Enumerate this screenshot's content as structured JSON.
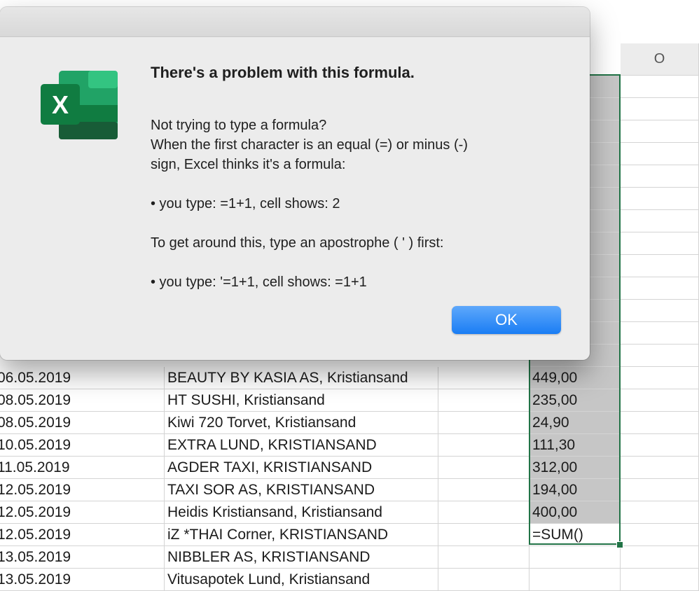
{
  "spreadsheet": {
    "column_o_header": "O",
    "rows": [
      {
        "date": "06.05.2019",
        "desc": "BEAUTY BY KASIA AS, Kristiansand",
        "amount": "449,00"
      },
      {
        "date": "08.05.2019",
        "desc": "HT SUSHI, Kristiansand",
        "amount": "235,00"
      },
      {
        "date": "08.05.2019",
        "desc": "Kiwi 720 Torvet, Kristiansand",
        "amount": "24,90"
      },
      {
        "date": "10.05.2019",
        "desc": "EXTRA LUND, KRISTIANSAND",
        "amount": "111,30"
      },
      {
        "date": "11.05.2019",
        "desc": "AGDER TAXI, KRISTIANSAND",
        "amount": "312,00"
      },
      {
        "date": "12.05.2019",
        "desc": "TAXI SOR AS, KRISTIANSAND",
        "amount": "194,00"
      },
      {
        "date": "12.05.2019",
        "desc": "Heidis Kristiansand, Kristiansand",
        "amount": "400,00"
      },
      {
        "date": "12.05.2019",
        "desc": "iZ *THAI Corner, KRISTIANSAND",
        "amount": "=SUM()"
      },
      {
        "date": "13.05.2019",
        "desc": "NIBBLER AS, KRISTIANSAND",
        "amount": ""
      },
      {
        "date": "13.05.2019",
        "desc": "Vitusapotek Lund, Kristiansand",
        "amount": ""
      }
    ],
    "accent_color": "#217346"
  },
  "dialog": {
    "icon": "excel-app-icon",
    "icon_letter": "X",
    "title": "There's a problem with this formula.",
    "line1": "Not trying to type a formula?",
    "line2": "When the first character is an equal (=) or minus (-)",
    "line3": "sign, Excel thinks it's a formula:",
    "example1": "• you type:   =1+1, cell shows:   2",
    "line4": "To get around this, type an apostrophe ( ' ) first:",
    "example2": "• you type:   '=1+1, cell shows:   =1+1",
    "ok_label": "OK",
    "ok_color": "#1a7df4"
  }
}
